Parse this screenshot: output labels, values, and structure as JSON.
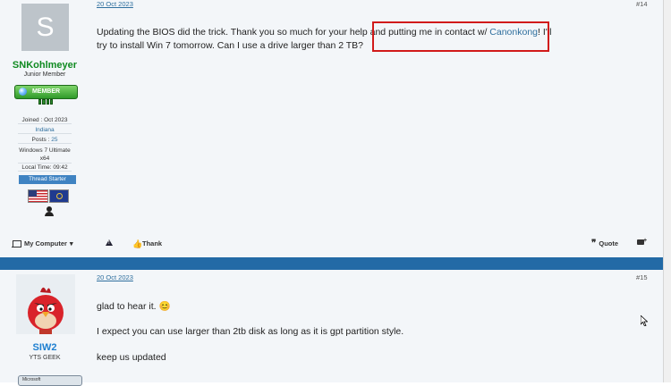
{
  "post14": {
    "date": "20 Oct 2023",
    "number": "#14",
    "user": {
      "avatar_letter": "S",
      "name": "SNKohlmeyer",
      "title": "Junior Member",
      "badge": "MEMBER",
      "joined": "Joined : Oct 2023",
      "location": "Indiana",
      "posts_label": "Posts : ",
      "posts_count": "25",
      "os": "Windows 7 Ultimate x64",
      "local_time": "Local Time: 09:42",
      "thread_starter": "Thread Starter"
    },
    "message": {
      "part1": "Updating the BIOS did the trick. Thank you so much for your help and putting me in contact w/ ",
      "link": "Canonkong",
      "part2": "! I'll try to install Win 7 tomorrow. Can I use a drive larger than 2 TB?"
    },
    "footer": {
      "my_computer": "My Computer",
      "thank": "Thank",
      "quote": "Quote"
    }
  },
  "post15": {
    "date": "20 Oct 2023",
    "number": "#15",
    "user": {
      "name": "SIW2",
      "title": "YTS GEEK",
      "badge": "Microsoft"
    },
    "message": {
      "line1": "glad to hear it.",
      "emoji": "😊",
      "line2": "I expect you can use larger than 2tb disk as long as it is gpt partition style.",
      "line3": "keep us updated"
    }
  },
  "colors": {
    "divider": "#236aa6",
    "link": "#2f6f9e",
    "highlight_box": "#d11a1a",
    "member_green": "#0f8a20",
    "geek_blue": "#1e7fd0"
  }
}
